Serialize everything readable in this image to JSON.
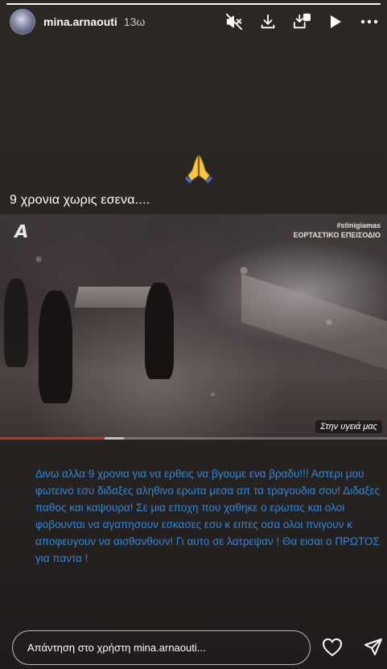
{
  "story": {
    "progress": 0.999,
    "user": {
      "username": "mina.arnaouti",
      "time": "13ω"
    },
    "header_icons": [
      "mute-icon",
      "download-icon",
      "save-icon",
      "play-icon",
      "more-icon"
    ],
    "emoji": "🙏",
    "caption_top": "9 χρονια χωρις εσενα....",
    "video": {
      "channel_logo": "A",
      "tag_line1": "#stinigiamas",
      "tag_line2": "ΕΟΡΤΑΣΤΙΚΟ ΕΠΕΙΣΟΔΙΟ",
      "banner": "Στην υγειά μας",
      "played_fraction": 0.27,
      "buffered_fraction": 0.32
    },
    "caption_main": "Δινω αλλα 9 χρονια για να ερθεις να βγουμε ενα βραδυ!!! Αστερι μου φωτεινο εσυ διδαξες αληθινο ερωτα μεσα απ τα τραγουδια σου! Διδαξες παθος και καψουρα! Σε μια εποχη που χαθηκε ο ερωτας και ολοι φοβουνται να αγαπησουν εσκασες εσυ  κ ειπες οσα ολοι πνιγουν κ αποφευγουν να αισθανθουν! Γι αυτο σε λατρεψαν ! Θα εισαι ο ΠΡΩΤΟΣ για παντα !"
  },
  "reply": {
    "placeholder": "Απάντηση στο χρήστη mina.arnaouti..."
  },
  "colors": {
    "caption_blue": "#2f87d9",
    "background": "#2a2624"
  }
}
